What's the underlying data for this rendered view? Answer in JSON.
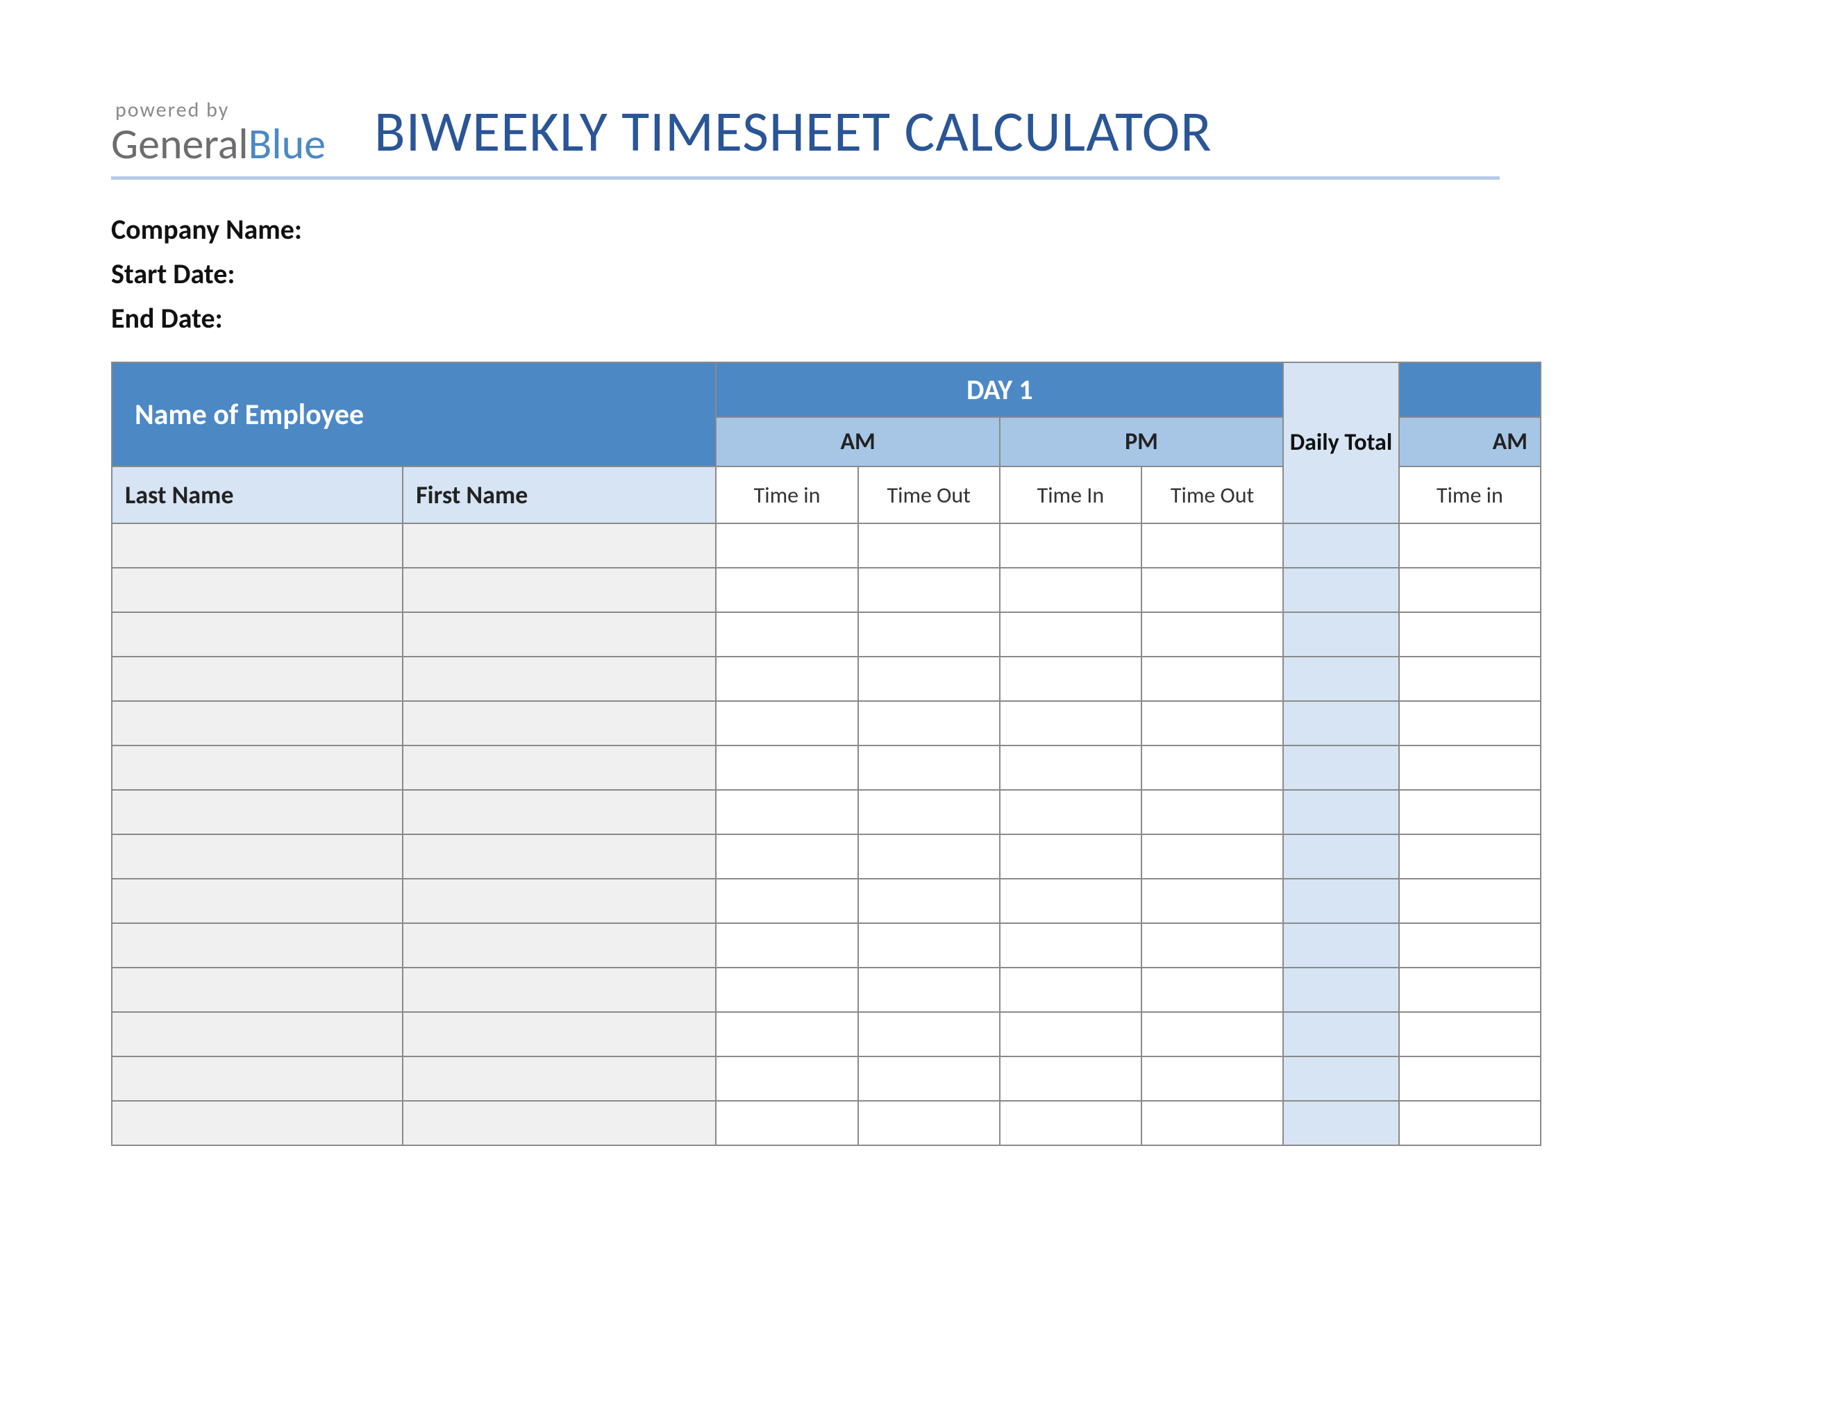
{
  "logo": {
    "powered_by": "powered by",
    "name_part1": "General",
    "name_part2": "Blue"
  },
  "title": "BIWEEKLY TIMESHEET CALCULATOR",
  "meta": {
    "company_label": "Company Name:",
    "start_label": "Start Date:",
    "end_label": "End Date:",
    "company_value": "",
    "start_value": "",
    "end_value": ""
  },
  "headers": {
    "name_of_employee": "Name of Employee",
    "day1": "DAY 1",
    "day2_partial": "",
    "am": "AM",
    "pm": "PM",
    "am2": "AM",
    "daily_total": "Daily Total",
    "last_name": "Last Name",
    "first_name": "First Name",
    "time_in": "Time in",
    "time_out": "Time Out",
    "time_in_cap": "Time In",
    "time_out2": "Time Out",
    "time_in2": "Time in"
  },
  "row_count": 14
}
